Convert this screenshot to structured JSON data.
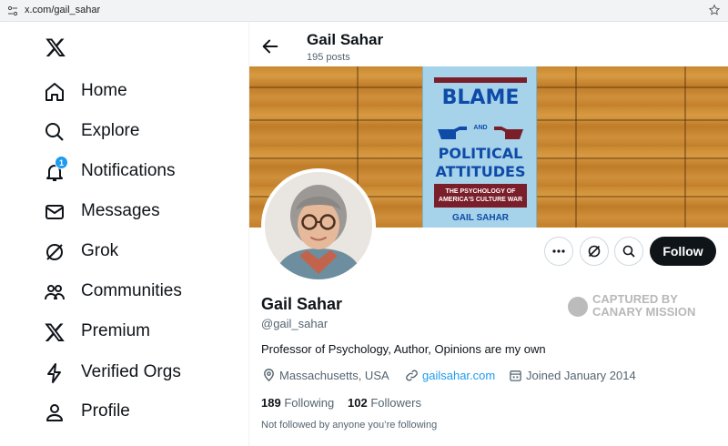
{
  "browser": {
    "url": "x.com/gail_sahar"
  },
  "nav": {
    "items": [
      {
        "label": "Home",
        "icon": "home-icon"
      },
      {
        "label": "Explore",
        "icon": "search-icon"
      },
      {
        "label": "Notifications",
        "icon": "bell-icon",
        "badge": "1"
      },
      {
        "label": "Messages",
        "icon": "mail-icon"
      },
      {
        "label": "Grok",
        "icon": "grok-icon"
      },
      {
        "label": "Communities",
        "icon": "people-icon"
      },
      {
        "label": "Premium",
        "icon": "x-logo-icon"
      },
      {
        "label": "Verified Orgs",
        "icon": "lightning-icon"
      },
      {
        "label": "Profile",
        "icon": "person-icon"
      }
    ]
  },
  "header": {
    "name": "Gail Sahar",
    "posts": "195 posts"
  },
  "banner": {
    "book_title_1": "BLAME",
    "book_and": "AND",
    "book_title_2": "POLITICAL",
    "book_title_3": "ATTITUDES",
    "book_subtitle_1": "THE PSYCHOLOGY OF",
    "book_subtitle_2": "AMERICA'S CULTURE WAR",
    "book_author": "GAIL SAHAR"
  },
  "actions": {
    "follow_label": "Follow"
  },
  "profile": {
    "name": "Gail Sahar",
    "handle": "@gail_sahar",
    "bio": "Professor of Psychology, Author, Opinions are my own",
    "location": "Massachusetts, USA",
    "website": "gailsahar.com",
    "joined": "Joined January 2014",
    "following_count": "189",
    "following_label": "Following",
    "followers_count": "102",
    "followers_label": "Followers",
    "not_followed": "Not followed by anyone you’re following"
  },
  "watermark": {
    "line1": "CAPTURED BY",
    "line2": "CANARY MISSION"
  },
  "colors": {
    "accent": "#1d9bf0",
    "text": "#0f1419",
    "muted": "#536471",
    "follow_bg": "#0f1419"
  }
}
